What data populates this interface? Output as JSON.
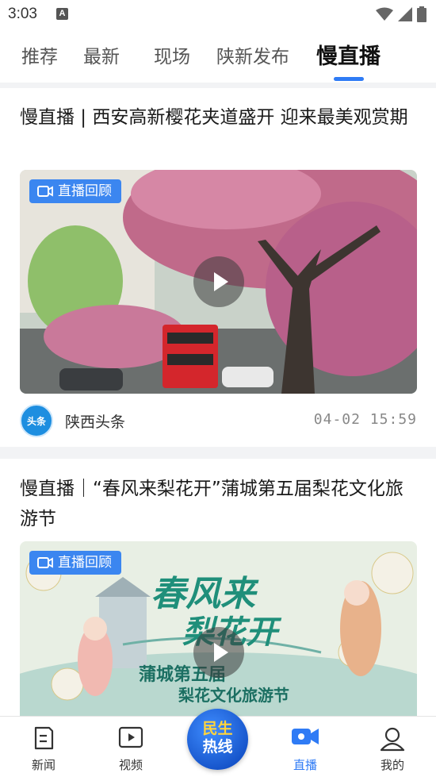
{
  "status": {
    "time": "3:03",
    "notif": "A"
  },
  "tabs": [
    {
      "label": "推荐"
    },
    {
      "label": "最新"
    },
    {
      "label": "现场"
    },
    {
      "label": "陕新发布"
    },
    {
      "label": "慢直播"
    }
  ],
  "active_tab": "慢直播",
  "cards": [
    {
      "title": "慢直播 | 西安高新樱花夹道盛开  迎来最美观赏期",
      "badge": "直播回顾",
      "source_logo": "头条",
      "source": "陕西头条",
      "time": "04-02  15:59"
    },
    {
      "title": "慢直播｜“春风来梨花开”蒲城第五届梨花文化旅游节",
      "badge": "直播回顾",
      "poster_title_1": "春风来",
      "poster_title_2": "梨花开",
      "poster_sub_1": "蒲城第五届",
      "poster_sub_2": "梨花文化旅游节"
    }
  ],
  "bottom_nav": {
    "news": "新闻",
    "video": "视频",
    "hotline_1": "民生",
    "hotline_2": "热线",
    "live": "直播",
    "mine": "我的"
  },
  "colors": {
    "accent": "#2f7bf5",
    "badge": "#3b86f0",
    "hotline_text": "#ffd43b"
  }
}
